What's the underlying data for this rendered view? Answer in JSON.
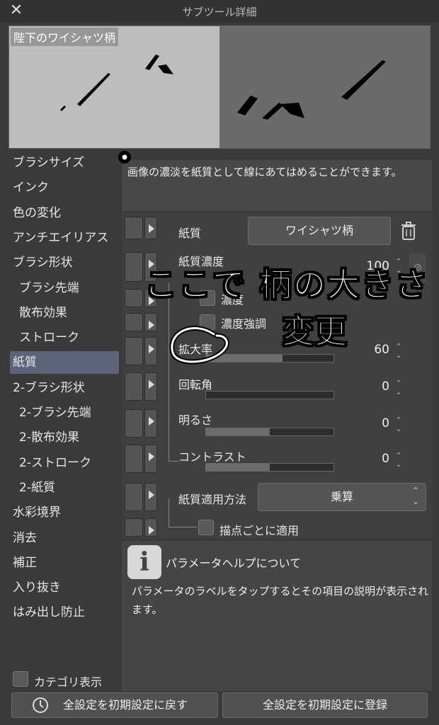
{
  "window": {
    "title": "サブツール詳細",
    "close_glyph": "✕"
  },
  "preview": {
    "preset_name": "陛下のワイシャツ柄"
  },
  "categories": [
    {
      "label": "ブラシサイズ",
      "sub": false,
      "selected": false
    },
    {
      "label": "インク",
      "sub": false,
      "selected": false
    },
    {
      "label": "色の変化",
      "sub": false,
      "selected": false
    },
    {
      "label": "アンチエイリアス",
      "sub": false,
      "selected": false
    },
    {
      "label": "ブラシ形状",
      "sub": false,
      "selected": false
    },
    {
      "label": "ブラシ先端",
      "sub": true,
      "selected": false
    },
    {
      "label": "散布効果",
      "sub": true,
      "selected": false
    },
    {
      "label": "ストローク",
      "sub": true,
      "selected": false
    },
    {
      "label": "紙質",
      "sub": false,
      "selected": true
    },
    {
      "label": "2-ブラシ形状",
      "sub": false,
      "selected": false
    },
    {
      "label": "2-ブラシ先端",
      "sub": true,
      "selected": false
    },
    {
      "label": "2-散布効果",
      "sub": true,
      "selected": false
    },
    {
      "label": "2-ストローク",
      "sub": true,
      "selected": false
    },
    {
      "label": "2-紙質",
      "sub": true,
      "selected": false
    },
    {
      "label": "水彩境界",
      "sub": false,
      "selected": false
    },
    {
      "label": "消去",
      "sub": false,
      "selected": false
    },
    {
      "label": "補正",
      "sub": false,
      "selected": false
    },
    {
      "label": "入り抜き",
      "sub": false,
      "selected": false
    },
    {
      "label": "はみ出し防止",
      "sub": false,
      "selected": false
    }
  ],
  "description": "画像の濃淡を紙質として線にあてはめることができます。",
  "params": {
    "texture": {
      "label": "紙質",
      "value": "ワイシャツ柄"
    },
    "density": {
      "label": "紙質濃度",
      "value": "100"
    },
    "density_check": {
      "label": "濃度"
    },
    "density_emphasis": {
      "label": "濃度強調"
    },
    "scale": {
      "label": "拡大率",
      "value": "60",
      "fraction": 0.6
    },
    "rotation": {
      "label": "回転角",
      "value": "0",
      "fraction": 0.0
    },
    "brightness": {
      "label": "明るさ",
      "value": "0",
      "fraction": 0.5
    },
    "contrast": {
      "label": "コントラスト",
      "value": "0",
      "fraction": 0.5
    },
    "blend_method": {
      "label": "紙質適用方法",
      "value": "乗算"
    },
    "per_dot": {
      "label": "描点ごとに適用"
    }
  },
  "help": {
    "title": "パラメータヘルプについて",
    "body": "パラメータのラベルをタップするとその項目の説明が表示されます。",
    "icon": "info-icon"
  },
  "bottom": {
    "category_toggle": "カテゴリ表示",
    "reset_button": "全設定を初期設定に戻す",
    "register_button": "全設定を初期設定に登録"
  },
  "annotation": {
    "line1": "ここで 柄の大きさ",
    "line2": "変更"
  }
}
